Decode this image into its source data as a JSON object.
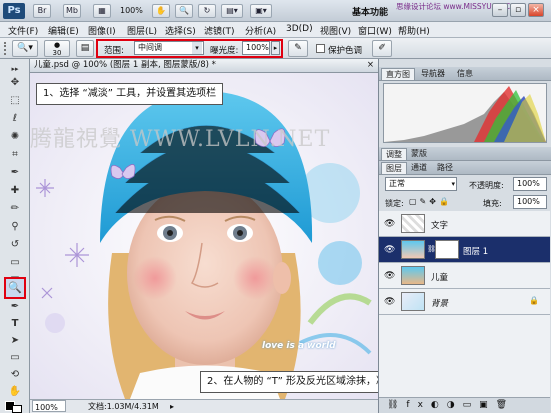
{
  "app": {
    "logo": "Ps",
    "bar_buttons": [
      "Br",
      "Mb"
    ],
    "zoom": "100%",
    "workspace": "基本功能",
    "site_watermark": "思缘设计论坛 www.MISSYUAN.COM"
  },
  "menubar": [
    "文件(F)",
    "编辑(E)",
    "图像(I)",
    "图层(L)",
    "选择(S)",
    "滤镜(T)",
    "分析(A)",
    "3D(D)",
    "视图(V)",
    "窗口(W)",
    "帮助(H)"
  ],
  "options": {
    "brush_size": "30",
    "range_label": "范围:",
    "range_value": "中间调",
    "exposure_label": "曝光度:",
    "exposure_value": "100%",
    "protect_tones": "保护色调"
  },
  "document": {
    "tab_title": "儿童.psd @ 100% (图层 1 副本, 图层蒙版/8) *",
    "zoom": "100%",
    "doc_size": "文档:1.03M/4.31M",
    "watermark": "腾龍視覺 WWW.LVLN.NET",
    "callout1": "1、选择 “减淡” 工具，并设置其选项栏",
    "callout2": "2、在人物的 “T” 形及反光区域涂抹，减淡皮肤的颜色",
    "image_text": "love is a world"
  },
  "histogram": {
    "tabs": [
      "直方图",
      "导航器",
      "信息"
    ]
  },
  "layers_panel": {
    "tabs": [
      "调整",
      "蒙版"
    ],
    "tabs2": [
      "图层",
      "通道",
      "路径"
    ],
    "blend_mode": "正常",
    "opacity_label": "不透明度:",
    "opacity_value": "100%",
    "lock_label": "锁定:",
    "fill_label": "填充:",
    "fill_value": "100%",
    "layers": [
      {
        "name": "文字",
        "selected": false
      },
      {
        "name": "图层 1",
        "selected": true
      },
      {
        "name": "儿童",
        "selected": false
      },
      {
        "name": "背景",
        "selected": false
      }
    ]
  }
}
